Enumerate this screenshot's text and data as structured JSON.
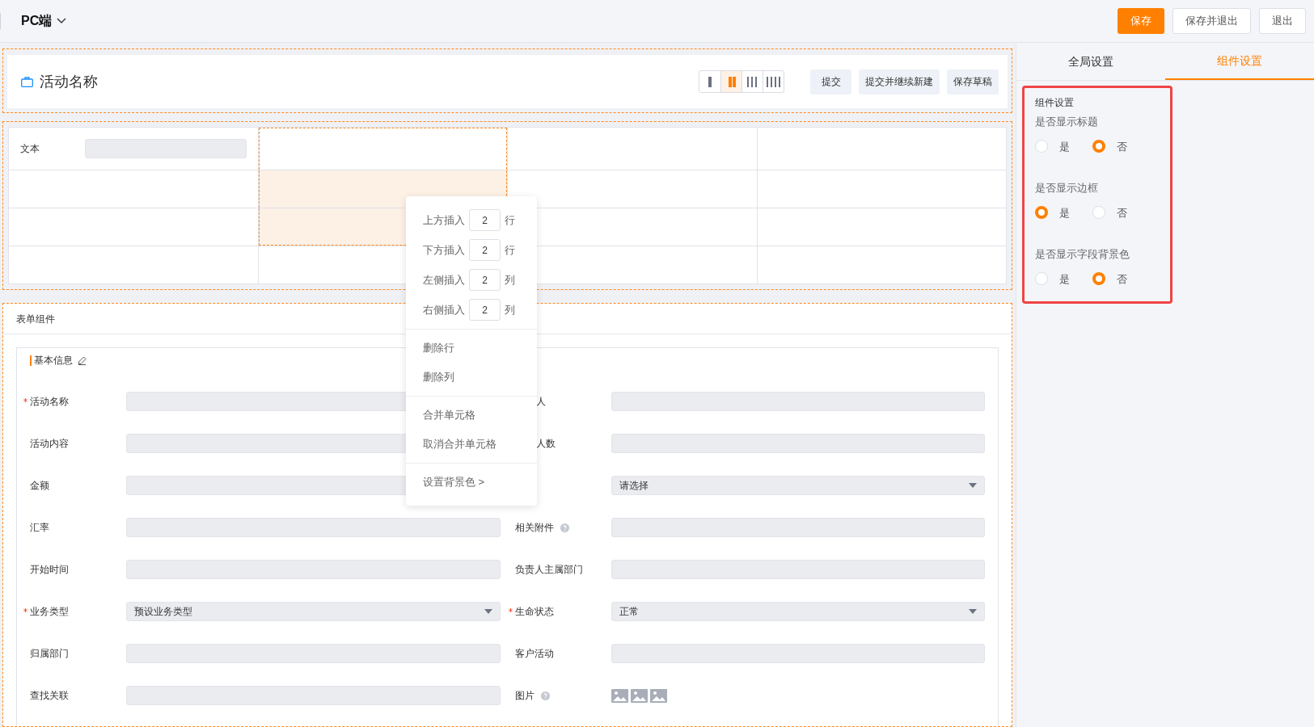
{
  "top_bar": {
    "title": "PC端",
    "buttons": [
      {
        "label": "保存",
        "kind": "primary"
      },
      {
        "label": "保存并退出",
        "kind": "default"
      },
      {
        "label": "退出",
        "kind": "default"
      }
    ]
  },
  "header": {
    "title": "活动名称",
    "layouts": [
      {
        "selected": false
      },
      {
        "selected": true
      },
      {
        "selected": false
      },
      {
        "selected": false
      }
    ],
    "buttons": [
      "提交",
      "提交并继续新建",
      "保存草稿"
    ]
  },
  "table": {
    "rows": [
      [
        {
          "label": "文本",
          "selected": false,
          "outlined": false
        },
        {
          "selected": false,
          "outlined": true
        },
        {
          "selected": false,
          "outlined": false
        },
        {
          "selected": false,
          "outlined": false
        }
      ],
      [
        {
          "selected": false,
          "outlined": false
        },
        {
          "selected": true,
          "outlined": true
        },
        {
          "selected": false,
          "outlined": false
        },
        {
          "selected": false,
          "outlined": false
        }
      ],
      [
        {
          "selected": false,
          "outlined": false
        },
        {
          "selected": true,
          "outlined": true
        },
        {
          "selected": false,
          "outlined": false
        },
        {
          "selected": false,
          "outlined": false
        }
      ],
      [
        {
          "selected": false,
          "outlined": false
        },
        {
          "selected": false,
          "outlined": false
        },
        {
          "selected": false,
          "outlined": false
        },
        {
          "selected": false,
          "outlined": false
        }
      ]
    ]
  },
  "context_menu": {
    "groups": [
      [
        {
          "kind": "insert",
          "label": "上方插入",
          "value": "2",
          "unit": "行"
        },
        {
          "kind": "insert",
          "label": "下方插入",
          "value": "2",
          "unit": "行"
        },
        {
          "kind": "insert",
          "label": "左侧插入",
          "value": "2",
          "unit": "列"
        },
        {
          "kind": "insert",
          "label": "右侧插入",
          "value": "2",
          "unit": "列"
        }
      ],
      [
        {
          "kind": "action",
          "label": "删除行"
        },
        {
          "kind": "action",
          "label": "删除列"
        }
      ],
      [
        {
          "kind": "action",
          "label": "合并单元格"
        },
        {
          "kind": "action",
          "label": "取消合并单元格"
        }
      ],
      [
        {
          "kind": "action",
          "label": "设置背景色 >"
        }
      ]
    ]
  },
  "form": {
    "title": "表单组件",
    "group": "基本信息",
    "rows": [
      [
        {
          "kind": "input",
          "label": "活动名称",
          "required": true
        },
        {
          "kind": "input",
          "label": "人",
          "covered": true
        }
      ],
      [
        {
          "kind": "input",
          "label": "活动内容"
        },
        {
          "kind": "input",
          "label": "人数",
          "covered": true
        }
      ],
      [
        {
          "kind": "input",
          "label": "金额"
        },
        {
          "kind": "select",
          "value": "请选择"
        }
      ],
      [
        {
          "kind": "input",
          "label": "汇率"
        },
        {
          "kind": "input",
          "label": "相关附件",
          "help": true
        }
      ],
      [
        {
          "kind": "input",
          "label": "开始时间"
        },
        {
          "kind": "input",
          "label": "负责人主属部门"
        }
      ],
      [
        {
          "kind": "select",
          "label": "业务类型",
          "value": "预设业务类型",
          "required": true
        },
        {
          "kind": "select",
          "label": "生命状态",
          "value": "正常",
          "required": true
        }
      ],
      [
        {
          "kind": "input",
          "label": "归属部门"
        },
        {
          "kind": "input",
          "label": "客户活动"
        }
      ],
      [
        {
          "kind": "input",
          "label": "查找关联"
        },
        {
          "kind": "images",
          "label": "图片",
          "help": true
        }
      ]
    ]
  },
  "settings_panel": {
    "tabs": [
      {
        "label": "全局设置",
        "selected": false
      },
      {
        "label": "组件设置",
        "selected": true
      }
    ],
    "title": "组件设置",
    "settings": [
      {
        "label": "是否显示标题",
        "options": [
          {
            "label": "是",
            "selected": false
          },
          {
            "label": "否",
            "selected": true
          }
        ]
      },
      {
        "label": "是否显示边框",
        "options": [
          {
            "label": "是",
            "selected": true
          },
          {
            "label": "否",
            "selected": false
          }
        ]
      },
      {
        "label": "是否显示字段背景色",
        "options": [
          {
            "label": "是",
            "selected": false
          },
          {
            "label": "否",
            "selected": true
          }
        ]
      }
    ]
  }
}
